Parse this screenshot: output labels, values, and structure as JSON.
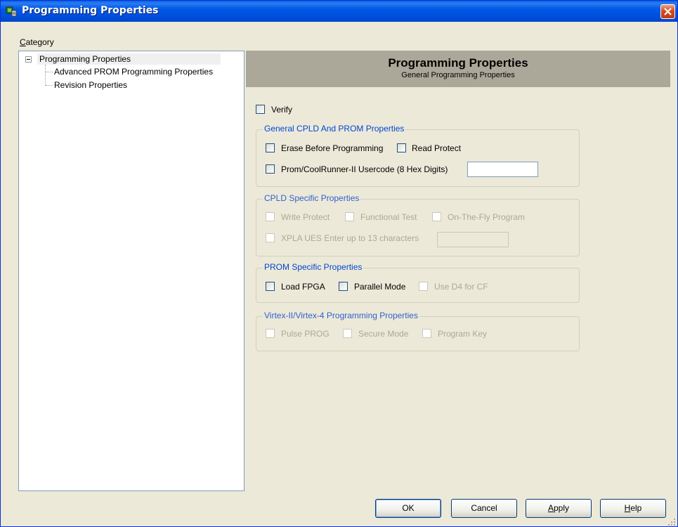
{
  "window": {
    "title": "Programming Properties",
    "close_icon": "close-icon"
  },
  "category": {
    "label_prefix": "C",
    "label_rest": "ategory",
    "tree": {
      "root": "Programming Properties",
      "children": [
        "Advanced PROM Programming Properties",
        "Revision Properties"
      ]
    }
  },
  "header": {
    "title": "Programming Properties",
    "subtitle": "General Programming Properties"
  },
  "verify": {
    "label": "Verify",
    "checked": false
  },
  "groups": {
    "general": {
      "title": "General CPLD And PROM Properties",
      "erase": "Erase Before Programming",
      "read_protect": "Read Protect",
      "usercode": "Prom/CoolRunner-II Usercode (8 Hex Digits)",
      "usercode_value": ""
    },
    "cpld": {
      "title": "CPLD Specific Properties",
      "write_protect": "Write Protect",
      "functional_test": "Functional Test",
      "on_the_fly": "On-The-Fly Program",
      "xpla_ues": "XPLA UES Enter up to 13 characters",
      "xpla_value": ""
    },
    "prom": {
      "title": "PROM Specific Properties",
      "load_fpga": "Load FPGA",
      "parallel_mode": "Parallel Mode",
      "use_d4": "Use D4 for CF"
    },
    "virtex": {
      "title": "Virtex-II/Virtex-4 Programming Properties",
      "pulse_prog": "Pulse PROG",
      "secure_mode": "Secure Mode",
      "program_key": "Program Key"
    }
  },
  "buttons": {
    "ok": "OK",
    "cancel": "Cancel",
    "apply_first": "A",
    "apply_rest": "pply",
    "help_first": "H",
    "help_rest": "elp"
  },
  "colors": {
    "titlebar": "#0058e6",
    "group_title": "#0046d5",
    "header_panel": "#aca899",
    "dialog_bg": "#ece9d8"
  }
}
